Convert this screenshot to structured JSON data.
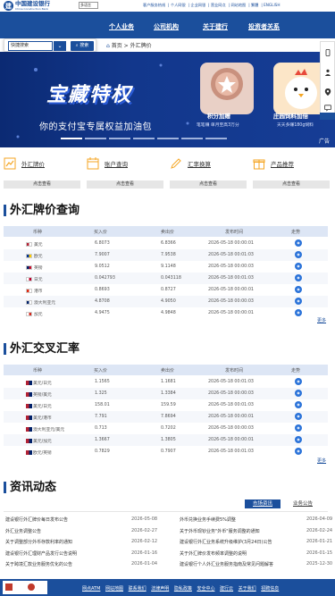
{
  "header": {
    "bank_name_cn": "中国建设银行",
    "bank_name_en": "China Construction Bank",
    "language_selector": "多语言",
    "top_links": [
      "客户服务热线",
      "个人网银",
      "企业网银",
      "营业网点",
      "网站地图",
      "繁體",
      "ENGLISH"
    ]
  },
  "nav": {
    "items": [
      "个人业务",
      "公司机构",
      "关于建行",
      "投资者关系"
    ]
  },
  "search": {
    "value": "快捷搜索",
    "button_label": "搜索"
  },
  "breadcrumb": {
    "items": [
      "首页",
      "外汇牌价"
    ]
  },
  "banner": {
    "title": "宝藏特权",
    "subtitle": "你的支付宝专属权益加油包",
    "card1_label": "积分加赠",
    "card1_sub": "笔笔赚 单月至高3万分",
    "card2_label": "庄园饲料加倍",
    "card2_sub": "天天多赚180g饲料",
    "ad_label": "广告"
  },
  "quick_links": [
    {
      "label": "外汇牌价",
      "button": "点击查看",
      "icon": "chart-icon"
    },
    {
      "label": "账户查询",
      "button": "点击查看",
      "icon": "calendar-icon"
    },
    {
      "label": "汇率换算",
      "button": "点击查看",
      "icon": "pen-icon"
    },
    {
      "label": "产品推荐",
      "button": "点击查看",
      "icon": "gift-icon"
    }
  ],
  "rate_table_1": {
    "title": "外汇牌价查询",
    "headers": [
      "币种",
      "买入价",
      "卖出价",
      "发布时间",
      "走势"
    ],
    "rows": [
      {
        "currency": "美元",
        "flag": "us",
        "buy": "6.8073",
        "sell": "6.8366",
        "time": "2026-05-18 00:00:01"
      },
      {
        "currency": "欧元",
        "flag": "eu",
        "buy": "7.9007",
        "sell": "7.9538",
        "time": "2026-05-18 00:01:03"
      },
      {
        "currency": "英镑",
        "flag": "gb",
        "buy": "9.0512",
        "sell": "9.1148",
        "time": "2026-05-18 00:00:03"
      },
      {
        "currency": "日元",
        "flag": "jp",
        "buy": "0.042793",
        "sell": "0.043118",
        "time": "2026-05-18 00:01:03"
      },
      {
        "currency": "港币",
        "flag": "hk",
        "buy": "0.8693",
        "sell": "0.8727",
        "time": "2026-05-18 00:00:01"
      },
      {
        "currency": "澳大利亚元",
        "flag": "au",
        "buy": "4.8708",
        "sell": "4.9050",
        "time": "2026-05-18 00:00:03"
      },
      {
        "currency": "加元",
        "flag": "ca",
        "buy": "4.9475",
        "sell": "4.9848",
        "time": "2026-05-18 00:00:01"
      }
    ],
    "more_label": "更多"
  },
  "rate_table_2": {
    "title": "外汇交叉汇率",
    "headers": [
      "币种",
      "买入价",
      "卖出价",
      "发布时间",
      "走势"
    ],
    "rows": [
      {
        "currency": "美元/日元",
        "buy": "1.1565",
        "sell": "1.1681",
        "time": "2026-05-18 00:01:03"
      },
      {
        "currency": "英镑/美元",
        "buy": "1.325",
        "sell": "1.3384",
        "time": "2026-05-18 00:00:03"
      },
      {
        "currency": "美元/日元",
        "buy": "158.01",
        "sell": "159.59",
        "time": "2026-05-18 00:01:03"
      },
      {
        "currency": "美元/港币",
        "buy": "7.791",
        "sell": "7.8694",
        "time": "2026-05-18 00:00:01"
      },
      {
        "currency": "澳大利亚元/美元",
        "buy": "0.713",
        "sell": "0.7202",
        "time": "2026-05-18 00:00:03"
      },
      {
        "currency": "美元/加元",
        "buy": "1.3667",
        "sell": "1.3805",
        "time": "2026-05-18 00:00:01"
      },
      {
        "currency": "欧元/英镑",
        "buy": "0.7829",
        "sell": "0.7907",
        "time": "2026-05-18 00:01:03"
      }
    ],
    "more_label": "更多"
  },
  "news": {
    "title": "资讯动态",
    "tabs": [
      "市场资讯",
      "业务公告"
    ],
    "left": [
      {
        "text": "建设银行外汇牌价每日发布公告",
        "date": "2026-05-08"
      },
      {
        "text": "外汇业务调整公告",
        "date": "2026-02-27"
      },
      {
        "text": "关于调整部分外币存款利率的通知",
        "date": "2026-02-12"
      },
      {
        "text": "建设银行外汇理财产品发行公告说明",
        "date": "2026-01-16"
      },
      {
        "text": "关于跨境汇款业务服务优化的公告",
        "date": "2026-01-04"
      }
    ],
    "right": [
      {
        "text": "外币兑换业务手续费5%调整",
        "date": "2026-04-09"
      },
      {
        "text": "关于外币现钞业务\"外币\"服务调整的通知",
        "date": "2026-02-24"
      },
      {
        "text": "建设银行外汇业务系统升级维护(3月24日)公告",
        "date": "2026-01-21"
      },
      {
        "text": "关于外汇牌价发布频率调整的说明",
        "date": "2026-01-15"
      },
      {
        "text": "建设银行个人外汇业务服务指南及常见问题解答",
        "date": "2025-12-30"
      }
    ]
  },
  "footer": {
    "links": [
      "网点ATM",
      "网站地图",
      "联系我们",
      "法律声明",
      "隐私政策",
      "安全中心",
      "建行云",
      "关于我们",
      "招聘信息"
    ]
  },
  "colors": {
    "brand": "#1b4f9c",
    "banner_bg": "#12378c",
    "eye_icon": "#2b73d9"
  }
}
